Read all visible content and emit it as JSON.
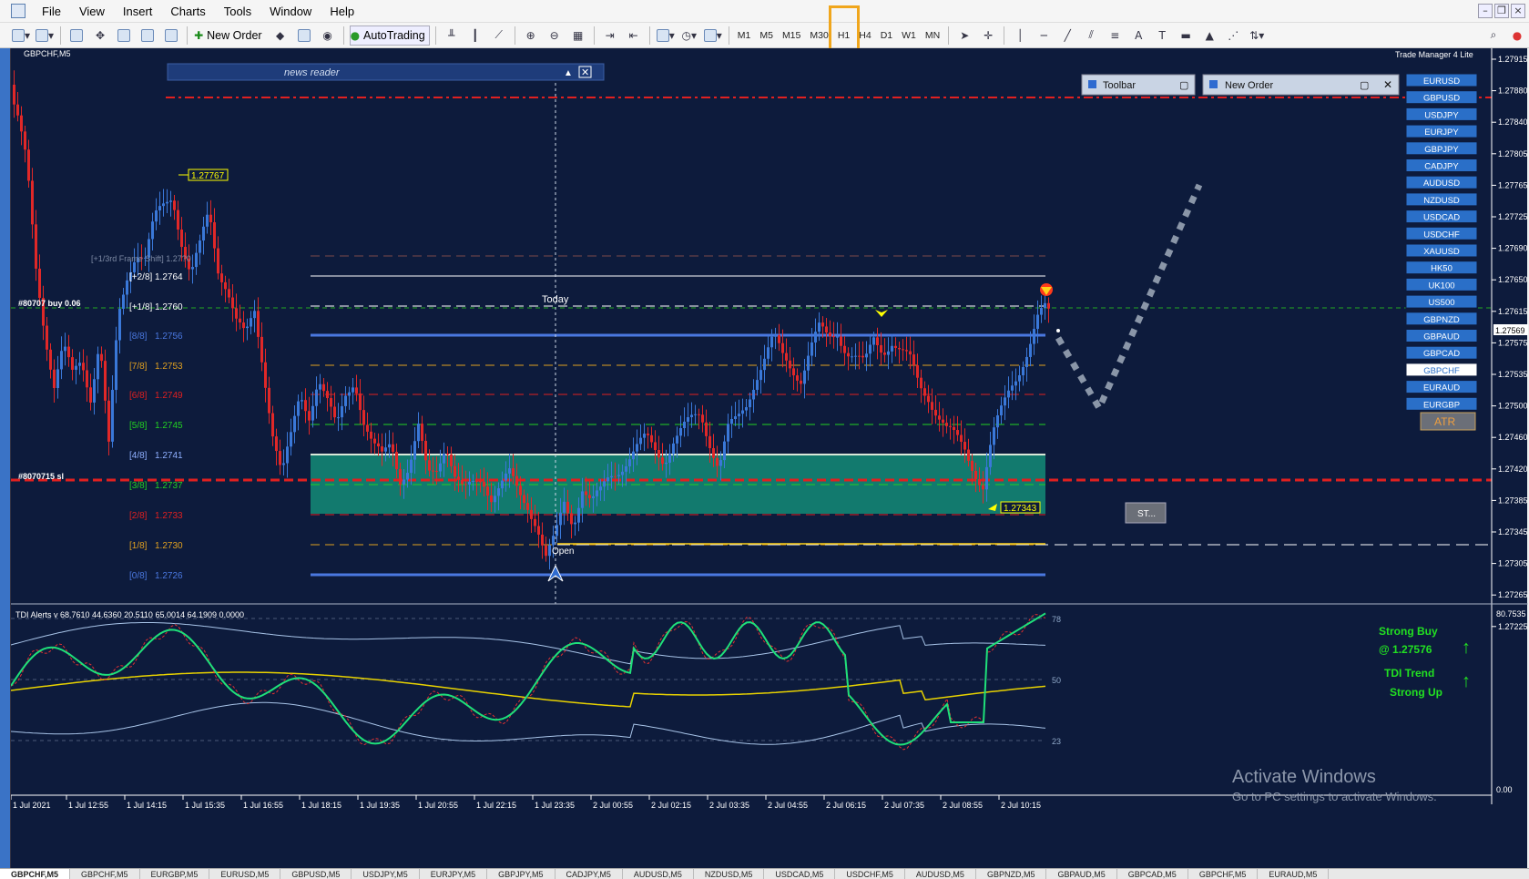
{
  "menu": [
    "File",
    "View",
    "Insert",
    "Charts",
    "Tools",
    "Window",
    "Help"
  ],
  "toolbar": {
    "new_order": "New Order",
    "autotrading": "AutoTrading"
  },
  "timeframes": [
    "M1",
    "M5",
    "M15",
    "M30",
    "H1",
    "H4",
    "D1",
    "W1",
    "MN"
  ],
  "chart": {
    "symbol_label": "GBPCHF,M5",
    "trade_manager": "Trade Manager 4 Lite",
    "news_reader": "news reader",
    "panel_toolbar": "Toolbar",
    "panel_new_order": "New Order",
    "high_label": "1.27767",
    "low_label": "1.27343",
    "today_label": "Today",
    "open_label": "Open",
    "frame_shift": "[+1/3rd Frame Shift] 1.27?0",
    "order_buy": "#80707 buy 0.06",
    "order_sl": "#8070715 sl",
    "st_button": "ST...",
    "atr_button": "ATR",
    "levels": [
      {
        "label": "[+2/8]",
        "value": "1.2764",
        "color": "#ffffff"
      },
      {
        "label": "[+1/8]",
        "value": "1.2760",
        "color": "#ffffff"
      },
      {
        "label": "[8/8]",
        "value": "1.2756",
        "color": "#4a78e0"
      },
      {
        "label": "[7/8]",
        "value": "1.2753",
        "color": "#e0a020"
      },
      {
        "label": "[6/8]",
        "value": "1.2749",
        "color": "#e02020"
      },
      {
        "label": "[5/8]",
        "value": "1.2745",
        "color": "#22d022"
      },
      {
        "label": "[4/8]",
        "value": "1.2741",
        "color": "#8fb0ff"
      },
      {
        "label": "[3/8]",
        "value": "1.2737",
        "color": "#22d022"
      },
      {
        "label": "[2/8]",
        "value": "1.2733",
        "color": "#e02020"
      },
      {
        "label": "[1/8]",
        "value": "1.2730",
        "color": "#e0a020"
      },
      {
        "label": "[0/8]",
        "value": "1.2726",
        "color": "#4a78e0"
      }
    ],
    "symbols": [
      "EURUSD",
      "GBPUSD",
      "USDJPY",
      "EURJPY",
      "GBPJPY",
      "CADJPY",
      "AUDUSD",
      "NZDUSD",
      "USDCAD",
      "USDCHF",
      "XAUUSD",
      "HK50",
      "UK100",
      "US500",
      "GBPNZD",
      "GBPAUD",
      "GBPCAD",
      "GBPCHF",
      "EURAUD",
      "EURGBP"
    ],
    "active_symbol": "GBPCHF",
    "price_axis": [
      "1.27915",
      "1.27880",
      "1.27840",
      "1.27805",
      "1.27765",
      "1.27725",
      "1.27690",
      "1.27650",
      "1.27615",
      "1.27575",
      "1.27535",
      "1.27500",
      "1.27460",
      "1.27420",
      "1.27385",
      "1.27345",
      "1.27305",
      "1.27265",
      "1.27225"
    ],
    "current_price": "1.27569",
    "time_axis": [
      "1 Jul 2021",
      "1 Jul 12:55",
      "1 Jul 14:15",
      "1 Jul 15:35",
      "1 Jul 16:55",
      "1 Jul 18:15",
      "1 Jul 19:35",
      "1 Jul 20:55",
      "1 Jul 22:15",
      "1 Jul 23:35",
      "2 Jul 00:55",
      "2 Jul 02:15",
      "2 Jul 03:35",
      "2 Jul 04:55",
      "2 Jul 06:15",
      "2 Jul 07:35",
      "2 Jul 08:55",
      "2 Jul 10:15"
    ]
  },
  "indicator": {
    "header": "TDI Alerts v 68.7610 44.6360 20.5110 65.0014 64.1909 0.0000",
    "axis_top": "80.7535",
    "axis_bottom": "0.00",
    "levels": [
      "78",
      "50",
      "23"
    ],
    "signal_1": "Strong Buy",
    "signal_1_price": "@ 1.27576",
    "signal_2": "TDI Trend",
    "signal_3": "Strong Up"
  },
  "watermark": {
    "title": "Activate Windows",
    "subtitle": "Go to PC settings to activate Windows."
  },
  "bottom_tabs": [
    "GBPCHF,M5",
    "GBPCHF,M5",
    "EURGBP,M5",
    "EURUSD,M5",
    "GBPUSD,M5",
    "USDJPY,M5",
    "EURJPY,M5",
    "GBPJPY,M5",
    "CADJPY,M5",
    "AUDUSD,M5",
    "NZDUSD,M5",
    "USDCAD,M5",
    "USDCHF,M5",
    "AUDUSD,M5",
    "GBPNZD,M5",
    "GBPAUD,M5",
    "GBPCAD,M5",
    "GBPCHF,M5",
    "EURAUD,M5"
  ],
  "colors": {
    "chart_bg": "#0d1b3c",
    "bull": "#3a78d8",
    "bear": "#e02828",
    "zone": "#127a6e",
    "tdi_green": "#1fe07a",
    "tdi_yellow": "#e8d200",
    "tdi_band": "#a8c4e8"
  }
}
